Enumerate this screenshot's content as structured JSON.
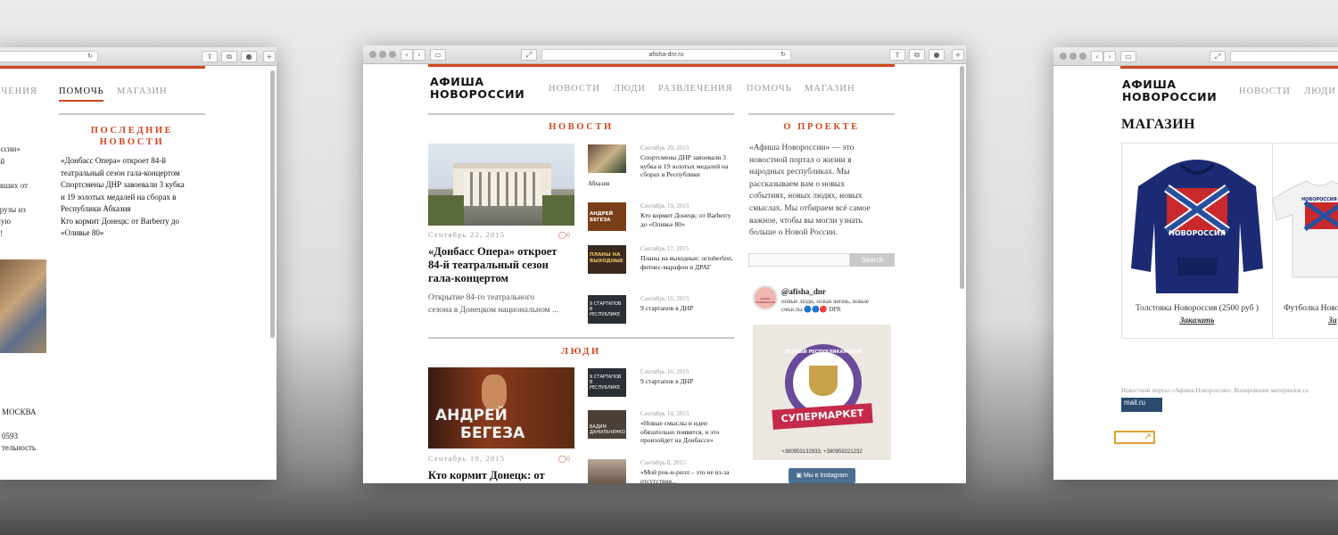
{
  "left": {
    "nav": [
      "ЕЧЕНИЯ",
      "ПОМОЧЬ",
      "МАГАЗИН"
    ],
    "latest_title": [
      "ПОСЛЕДНИЕ",
      "НОВОСТИ"
    ],
    "latest_lines": [
      "«Донбасс Опера» откроет 84-й",
      "театральный сезон гала-концертом",
      "Спортсмены ДНР завоевали 3 кубка",
      "и 19 золотых медалей на сборах в",
      "Республики Абхазия",
      "Кто кормит Донецк: от Barberry до",
      "«Оливье 80»"
    ],
    "cut_lines": [
      "оссии»",
      "ой",
      "я",
      "авших от",
      "е",
      "грузы из",
      "ную",
      "е!"
    ],
    "bottom_lines": [
      "МОСКВА",
      "0593",
      "тельность"
    ]
  },
  "center": {
    "url": "afisha-dnr.ru",
    "logo": [
      "АФИША",
      "НОВОРОССИИ"
    ],
    "nav": [
      "НОВОСТИ",
      "ЛЮДИ",
      "РАЗВЛЕЧЕНИЯ",
      "ПОМОЧЬ",
      "МАГАЗИН"
    ],
    "news_heading": "НОВОСТИ",
    "main_news": {
      "date": "Сентябрь 22, 2015",
      "comments": "0",
      "title": [
        "«Донбасс Опера» откроет",
        "84-й театральный сезон",
        "гала-концертом"
      ],
      "excerpt": [
        "Открытие 84-го театрального",
        "сезона в Донецком национальном ..."
      ]
    },
    "side_news": [
      {
        "date": "Сентябрь 20, 2015",
        "title": "Спортсмены ДНР завоевали 3 кубка и 19 золотых медалей на сборах в Республики",
        "extra": "Абхазия"
      },
      {
        "date": "Сентябрь 19, 2015",
        "title": "Кто кормит Донецк: от Barberry до «Оливье 80»",
        "thumb_text": "АНДРЕЙ БЕГЕЗА"
      },
      {
        "date": "Сентябрь 17, 2015",
        "title": "Планы на выходные: octoberfest, фитнес-марафон и ДРАГ",
        "thumb_text": "ПЛАНЫ НА ВЫХОДНЫЕ"
      },
      {
        "date": "Сентябрь 16, 2015",
        "title": "9 стартапов в ДНР",
        "thumb_text": "9 СТАРТАПОВ В РЕСПУБЛИКЕ"
      }
    ],
    "people_heading": "ЛЮДИ",
    "people_main": {
      "image_text": [
        "АНДРЕЙ",
        "БЕГЕЗА"
      ],
      "date": "Сентябрь 19, 2015",
      "comments": "0",
      "title": "Кто кормит Донецк: от"
    },
    "people_side": [
      {
        "date": "Сентябрь 16, 2015",
        "title": "9 стартапов в ДНР",
        "thumb_text": "9 СТАРТАПОВ В РЕСПУБЛИКЕ"
      },
      {
        "date": "Сентябрь 14, 2015",
        "title": "«Новые смыслы и идеи обязательно появятся, и это произойдет на Донбассе»",
        "thumb_text": "ВАДИМ ДАНИЛЬЧЕНКО"
      },
      {
        "date": "Сентябрь 8, 2015",
        "title": "«Мой рок-н-ролл – это не из-за отсутствия..."
      }
    ],
    "about_heading": "О ПРОЕКТЕ",
    "about_text": [
      "«Афиша Новороссии» — это",
      "новостной портал о жизни в",
      "народных республиках. Мы",
      "рассказываем вам о новых",
      "событиях, новых людях, новых",
      "смыслах. Мы отбираем всё самое",
      "важное, чтобы вы могли узнать",
      "больше о Новой России."
    ],
    "search_placeholder": "",
    "search_button": "Search",
    "insta_handle": "@afisha_dnr",
    "insta_bio": [
      "новые люди, новая жизнь, новые",
      "смыслы 🔵🔵🔴 DPR"
    ],
    "insta_badge": "АФИША НОВОРОССИИ",
    "insta_image": {
      "ring": "ПЕРВЫЙ РЕСПУБЛИКАНСКИЙ",
      "ribbon": "СУПЕРМАРКЕТ",
      "phones": "+380953132933, +380959221232"
    },
    "insta_button": "Мы в Instagram"
  },
  "right": {
    "logo": [
      "АФИША",
      "НОВОРОССИИ"
    ],
    "nav": [
      "НОВОСТИ",
      "ЛЮДИ"
    ],
    "shop_title": "МАГАЗИН",
    "products": [
      {
        "name": "Толстовка Новороссия (2500 руб )",
        "order": "Заказать",
        "print": "НОВОРОССИЯ"
      },
      {
        "name": "Футболка Новоро",
        "order": "За",
        "print": "НОВОРОССИЯ"
      }
    ],
    "footer": "Новостной портал «Афиша Новороссии». Копирование материалов са",
    "badge": "mail.ru"
  },
  "colors": {
    "accent": "#d2451e",
    "hoodie": "#1c2a74",
    "flag_red": "#c9282d",
    "flag_blue": "#2a4f9e"
  }
}
